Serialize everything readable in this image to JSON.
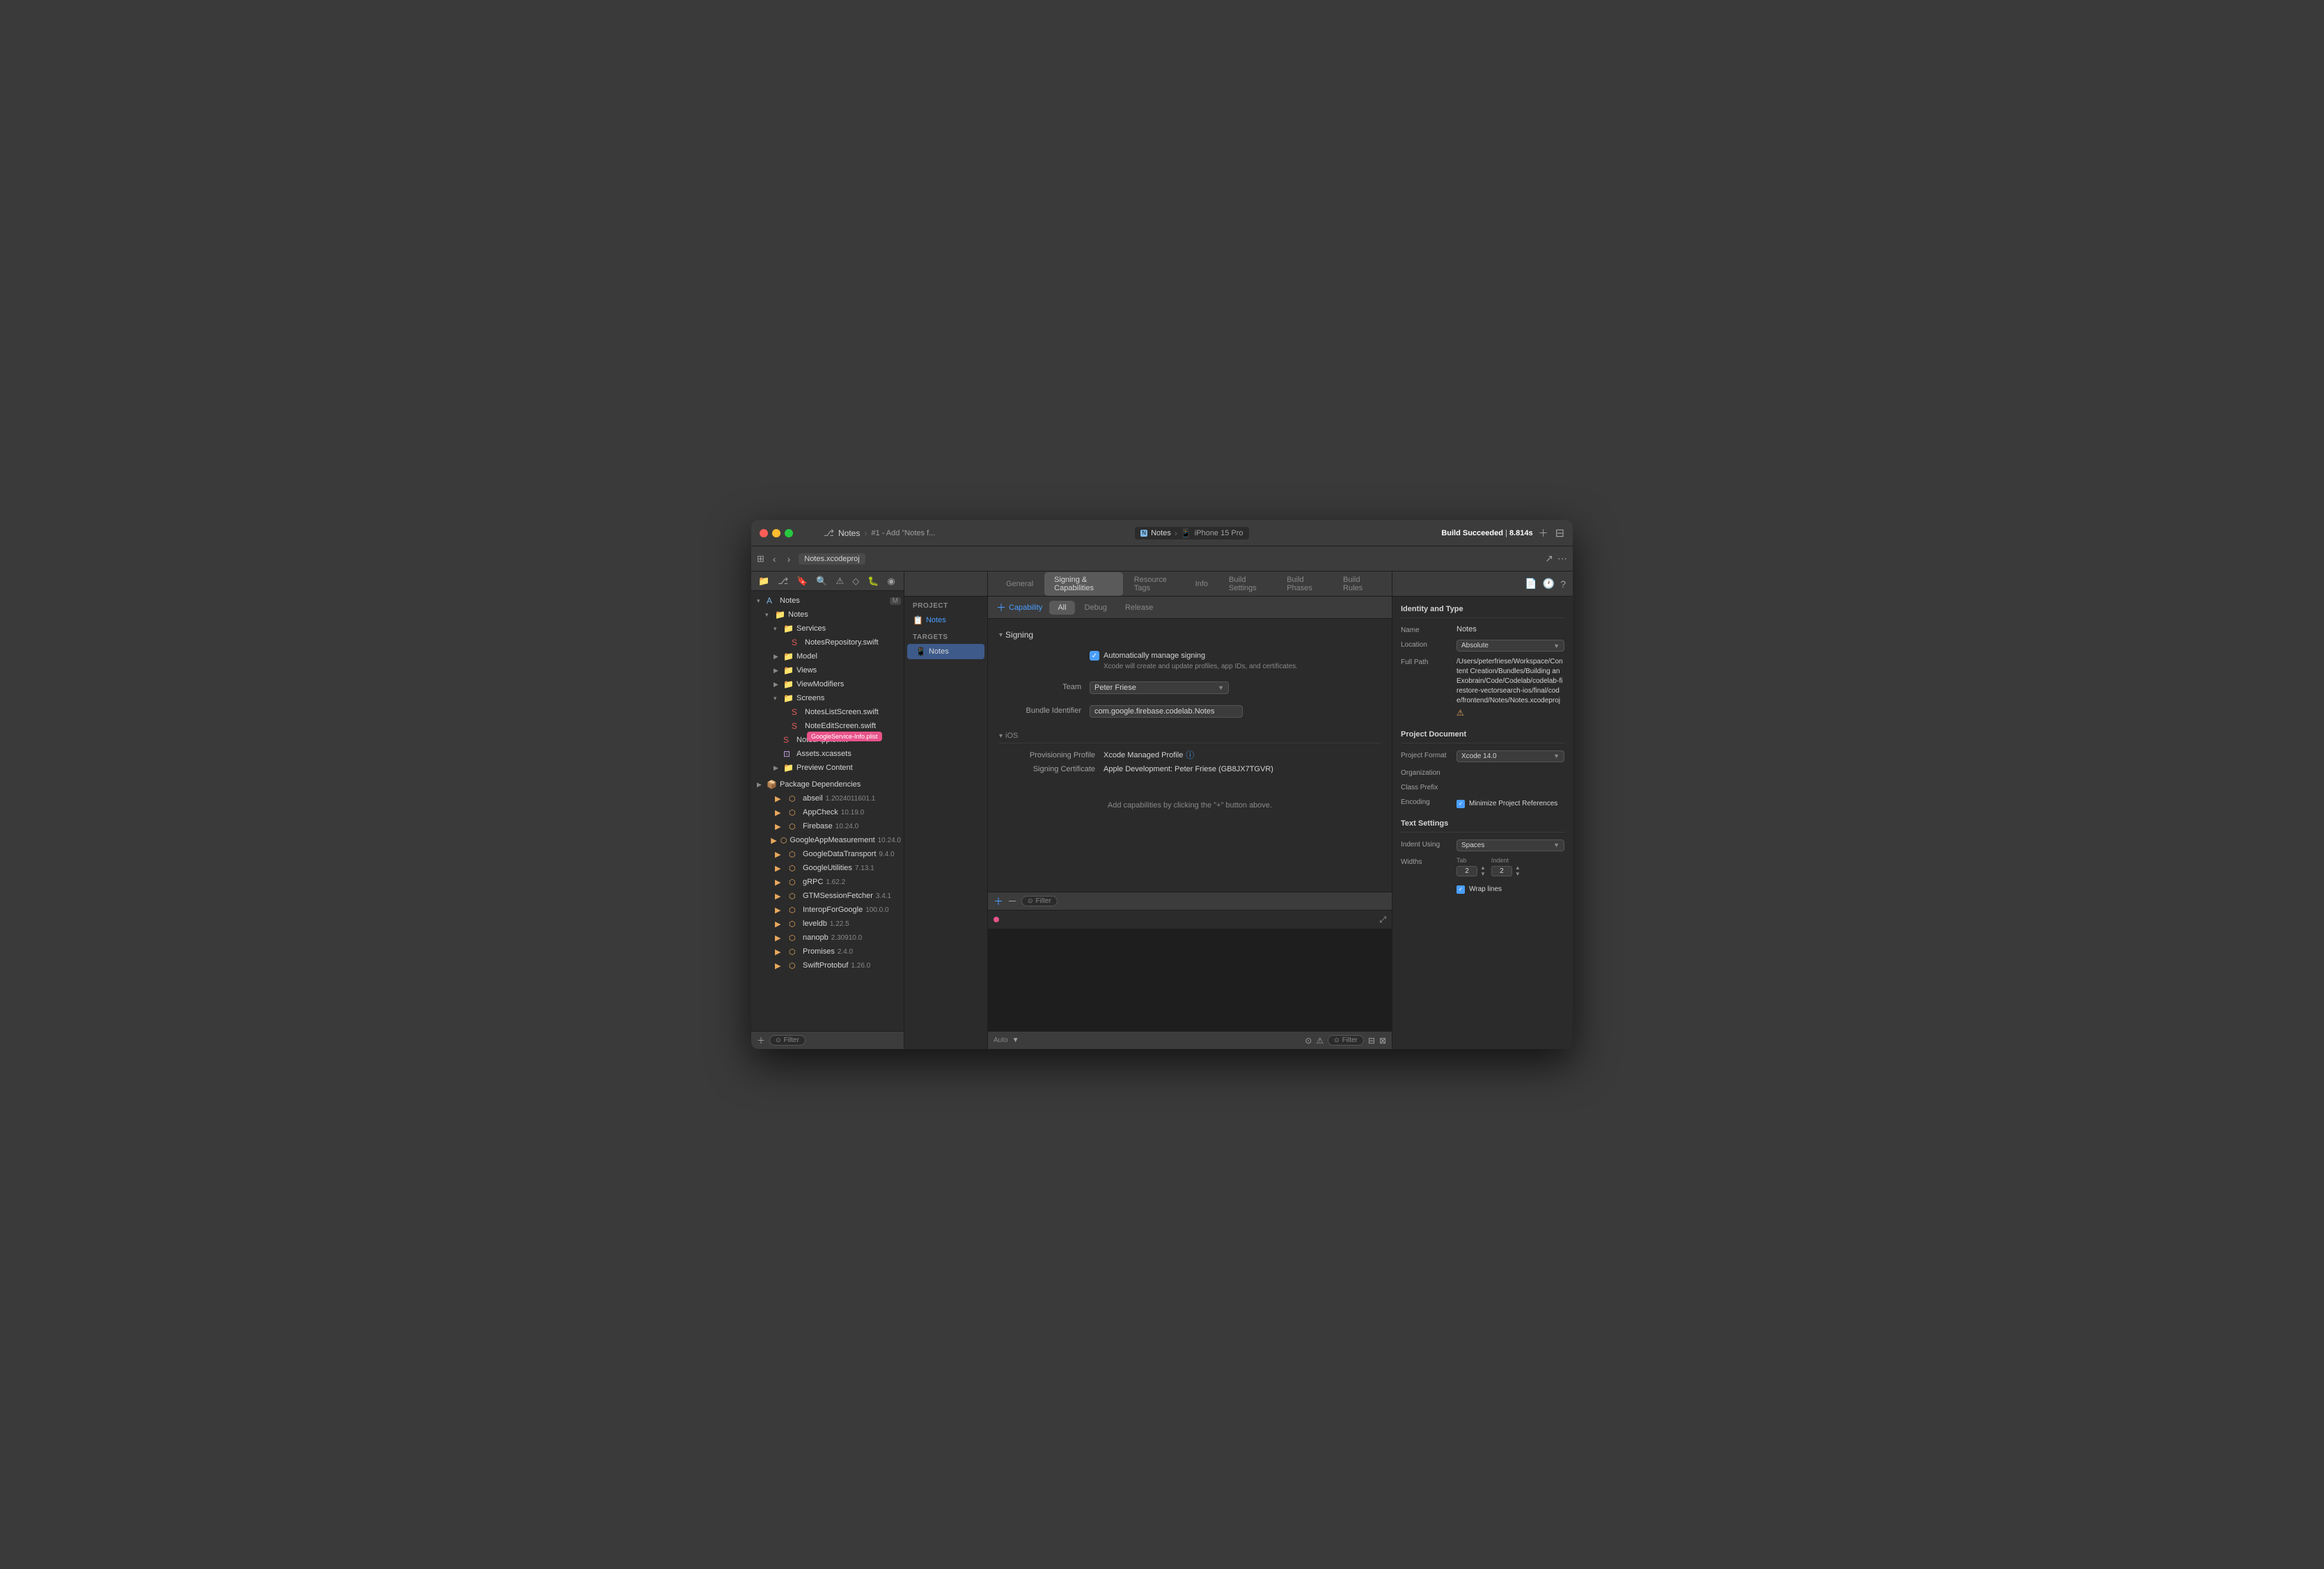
{
  "window": {
    "title": "Notes",
    "subtitle": "#1 - Add \"Notes f...",
    "build_status": "Build Succeeded",
    "build_time": "8.814s",
    "breadcrumb_file": "Notes.xcodeproj"
  },
  "toolbar": {
    "notes_tab": "Notes",
    "simulator": "iPhone 15 Pro"
  },
  "sidebar": {
    "root_label": "Notes",
    "badge": "M",
    "items": [
      {
        "label": "Notes",
        "type": "folder",
        "indent": 1,
        "expanded": true
      },
      {
        "label": "Services",
        "type": "folder",
        "indent": 2,
        "expanded": true
      },
      {
        "label": "NotesRepository.swift",
        "type": "swift",
        "indent": 3
      },
      {
        "label": "Model",
        "type": "folder",
        "indent": 2,
        "expanded": false
      },
      {
        "label": "Views",
        "type": "folder",
        "indent": 2,
        "expanded": false
      },
      {
        "label": "ViewModifiers",
        "type": "folder",
        "indent": 2,
        "expanded": false
      },
      {
        "label": "Screens",
        "type": "folder",
        "indent": 2,
        "expanded": true
      },
      {
        "label": "NotesListScreen.swift",
        "type": "swift",
        "indent": 3
      },
      {
        "label": "NoteEditScreen.swift",
        "type": "swift",
        "indent": 3
      },
      {
        "label": "NotesApp.swift",
        "type": "swift",
        "indent": 3
      },
      {
        "label": "Assets.xcassets",
        "type": "asset",
        "indent": 2
      },
      {
        "label": "Preview Content",
        "type": "folder",
        "indent": 2,
        "expanded": false
      }
    ],
    "pkg_deps_label": "Package Dependencies",
    "packages": [
      {
        "label": "abseil",
        "version": "1.2024011601.1"
      },
      {
        "label": "AppCheck",
        "version": "10.19.0"
      },
      {
        "label": "Firebase",
        "version": "10.24.0"
      },
      {
        "label": "GoogleAppMeasurement",
        "version": "10.24.0"
      },
      {
        "label": "GoogleDataTransport",
        "version": "9.4.0"
      },
      {
        "label": "GoogleUtilities",
        "version": "7.13.1"
      },
      {
        "label": "gRPC",
        "version": "1.62.2"
      },
      {
        "label": "GTMSessionFetcher",
        "version": "3.4.1"
      },
      {
        "label": "InteropForGoogle",
        "version": "100.0.0"
      },
      {
        "label": "leveldb",
        "version": "1.22.5"
      },
      {
        "label": "nanopb",
        "version": "2.30910.0"
      },
      {
        "label": "Promises",
        "version": "2.4.0"
      },
      {
        "label": "SwiftProtobuf",
        "version": "1.26.0"
      }
    ],
    "filter_placeholder": "Filter"
  },
  "navigator": {
    "project_label": "PROJECT",
    "project_item": "Notes",
    "targets_label": "TARGETS",
    "targets_item": "Notes"
  },
  "settings_tabs": [
    {
      "label": "General",
      "active": false
    },
    {
      "label": "Signing & Capabilities",
      "active": true
    },
    {
      "label": "Resource Tags",
      "active": false
    },
    {
      "label": "Info",
      "active": false
    },
    {
      "label": "Build Settings",
      "active": false
    },
    {
      "label": "Build Phases",
      "active": false
    },
    {
      "label": "Build Rules",
      "active": false
    }
  ],
  "capability_tabs": [
    {
      "label": "All",
      "active": true
    },
    {
      "label": "Debug",
      "active": false
    },
    {
      "label": "Release",
      "active": false
    }
  ],
  "signing": {
    "add_capability_label": "+ Capability",
    "section_label": "Signing",
    "auto_manage_label": "Automatically manage signing",
    "auto_manage_sublabel": "Xcode will create and update profiles, app IDs, and certificates.",
    "team_label": "Team",
    "team_value": "Peter Friese",
    "bundle_label": "Bundle Identifier",
    "bundle_value": "com.google.firebase.codelab.Notes",
    "ios_section_label": "iOS",
    "prov_profile_label": "Provisioning Profile",
    "prov_profile_value": "Xcode Managed Profile",
    "signing_cert_label": "Signing Certificate",
    "signing_cert_value": "Apple Development: Peter Friese (GB8JX7TGVR)",
    "add_hint": "Add capabilities by clicking the \"+\" button above."
  },
  "debugger": {
    "filter_placeholder": "Filter",
    "auto_label": "Auto"
  },
  "inspector": {
    "toolbar_icons": [
      "file-icon",
      "clock-icon",
      "help-icon"
    ],
    "identity_section": "Identity and Type",
    "name_label": "Name",
    "name_value": "Notes",
    "location_label": "Location",
    "location_value": "Absolute",
    "full_path_label": "Full Path",
    "full_path_value": "/Users/peterfriese/Workspace/Content Creation/Bundles/Building an Exobrain/Code/Codelab/codelab-firestore-vectorsearch-ios/final/code/frontend/Notes/Notes.xcodeproj",
    "project_doc_section": "Project Document",
    "project_format_label": "Project Format",
    "project_format_value": "Xcode 14.0",
    "org_label": "Organization",
    "class_prefix_label": "Class Prefix",
    "encoding_label": "Encoding",
    "encoding_value": "Minimize Project References",
    "text_settings_section": "Text Settings",
    "indent_using_label": "Indent Using",
    "indent_using_value": "Spaces",
    "widths_label": "Widths",
    "tab_label": "Tab",
    "tab_value": "2",
    "indent_label": "Indent",
    "indent_value": "2",
    "wrap_lines_label": "Wrap lines"
  },
  "tooltip": {
    "text": "GoogleService-Info.plist",
    "color": "#e8538a"
  }
}
